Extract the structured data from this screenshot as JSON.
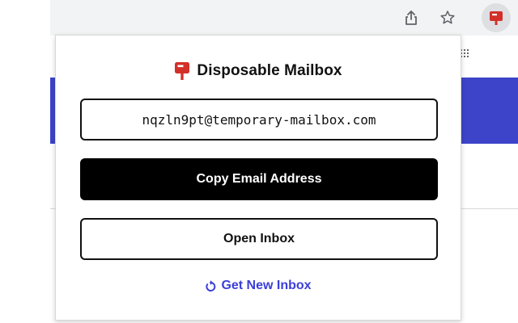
{
  "browser": {
    "toolbar_icons": [
      "share-icon",
      "star-icon",
      "disposable-mailbox-extension-icon"
    ]
  },
  "popup": {
    "title": "Disposable Mailbox",
    "logo_icon": "mailbox-logo-icon",
    "email_address": "nqzln9pt@temporary-mailbox.com",
    "copy_button_label": "Copy Email Address",
    "open_inbox_label": "Open Inbox",
    "new_inbox_label": "Get New Inbox",
    "new_inbox_icon": "refresh-icon"
  },
  "colors": {
    "brand_red": "#d3302a",
    "link_blue": "#3b3fd9",
    "page_band": "#3d44c9",
    "primary_button": "#000000"
  }
}
